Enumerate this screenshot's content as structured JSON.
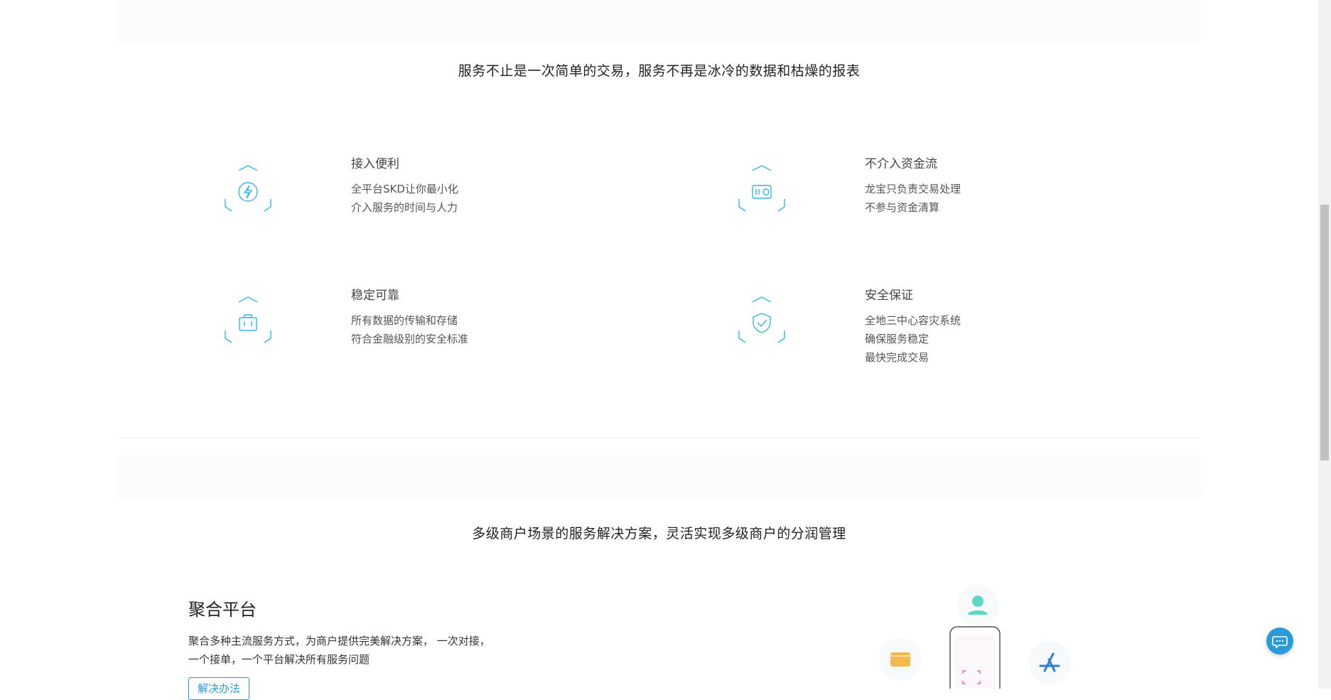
{
  "section1": {
    "title": "服务不止是一次简单的交易，服务不再是冰冷的数据和枯燥的报表",
    "features": [
      {
        "title": "接入便利",
        "lines": [
          "全平台SKD让你最小化",
          "介入服务的时间与人力"
        ],
        "icon": "lightning-icon"
      },
      {
        "title": "不介入资金流",
        "lines": [
          "龙宝只负责交易处理",
          "不参与资金清算"
        ],
        "icon": "safe-box-icon"
      },
      {
        "title": "稳定可靠",
        "lines": [
          "所有数据的传输和存储",
          "符合金融级别的安全标准"
        ],
        "icon": "briefcase-icon"
      },
      {
        "title": "安全保证",
        "lines": [
          "全地三中心容灾系统",
          "确保服务稳定",
          "最快完成交易"
        ],
        "icon": "shield-check-icon"
      }
    ]
  },
  "section2": {
    "title": "多级商户场景的服务解决方案，灵活实现多级商户的分润管理",
    "aggregate": {
      "title": "聚合平台",
      "desc_line1": "聚合多种主流服务方式，为商户提供完美解决方案， 一次对接，",
      "desc_line2": "一个接单，一个平台解决所有服务问题",
      "button": "解决办法"
    },
    "illustration_icons": [
      "user-icon",
      "card-icon",
      "app-store-icon",
      "phone-icon"
    ]
  },
  "colors": {
    "accent": "#2a9bd8",
    "icon_cyan": "#35b6e8",
    "divider": "#eef0f3"
  },
  "chat": {
    "icon": "chat-bubble-icon"
  }
}
